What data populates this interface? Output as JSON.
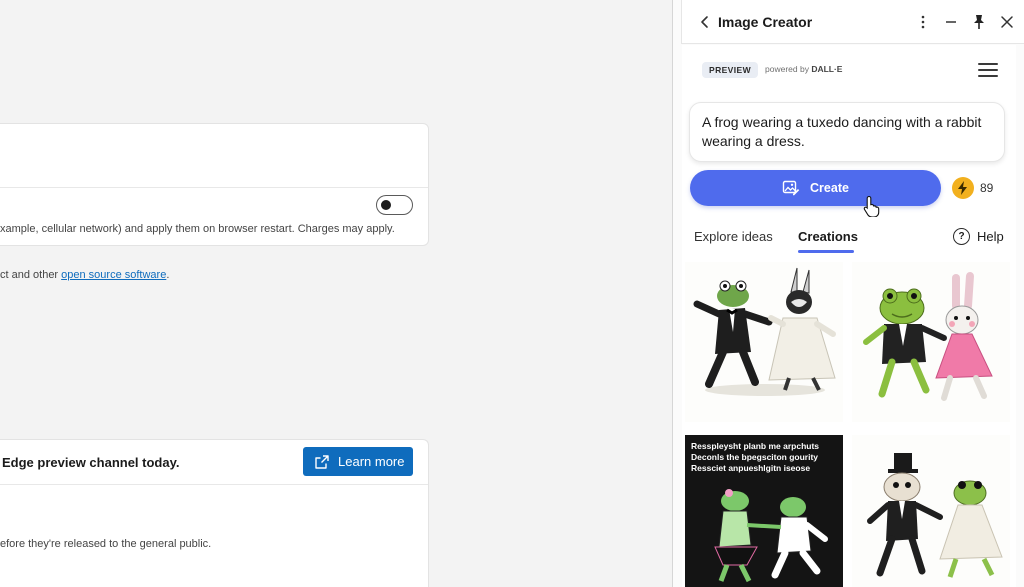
{
  "settings": {
    "card1": {
      "description": "xample, cellular network) and apply them on browser restart. Charges may apply."
    },
    "open_source": {
      "prefix": "ct and other ",
      "link": "open source software",
      "suffix": "."
    },
    "card2": {
      "heading": "Edge preview channel today.",
      "button": "Learn more",
      "description": "efore they're released to the general public."
    },
    "toggle_on": false
  },
  "panel": {
    "title": "Image Creator",
    "badge": "PREVIEW",
    "powered_prefix": "powered by ",
    "powered_brand": "DALL·E",
    "prompt": "A frog wearing a tuxedo dancing with a rabbit wearing a dress.",
    "create_label": "Create",
    "boost_count": "89",
    "tabs": [
      {
        "label": "Explore ideas",
        "active": false
      },
      {
        "label": "Creations",
        "active": true
      }
    ],
    "help_label": "Help",
    "help_glyph": "?",
    "gallery_text": "Resspleysht planb me arpchuts Deconls the bpegsciton gourity Ressciet anpueshlgitn iseose"
  },
  "colors": {
    "accent": "#4f6bed",
    "edge_blue": "#0f6cbd",
    "boost": "#f2b01e"
  },
  "icons": [
    "back-icon",
    "more-icon",
    "minimize-icon",
    "pin-icon",
    "close-icon",
    "hamburger-menu-icon",
    "image-create-icon",
    "bolt-icon",
    "help-icon",
    "external-link-icon",
    "pointer-cursor-icon"
  ]
}
